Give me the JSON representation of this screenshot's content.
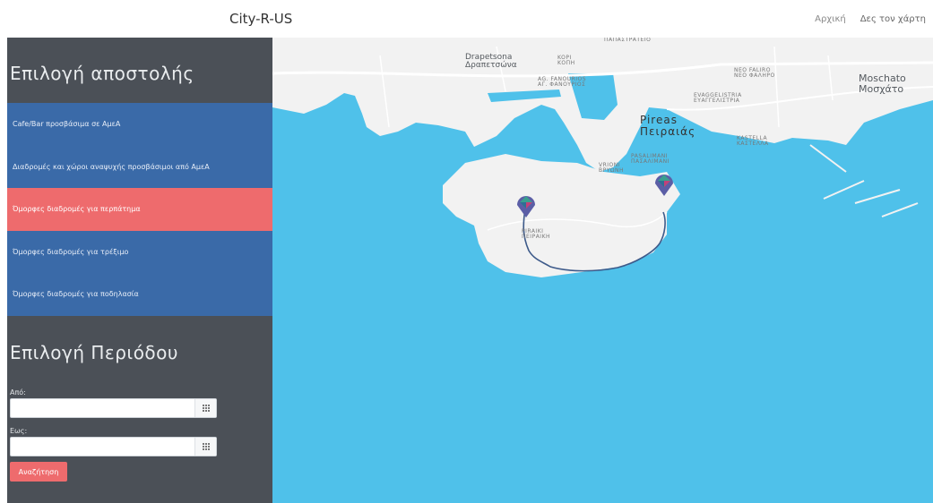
{
  "navbar": {
    "brand": "City-R-US",
    "links": [
      {
        "label": "Αρχική"
      },
      {
        "label": "Δες τον χάρτη"
      }
    ]
  },
  "sidebar": {
    "mission_heading": "Επιλογή αποστολής",
    "missions": [
      {
        "label": "Cafe/Bar προσβάσιμα σε ΑμεΑ",
        "active": false
      },
      {
        "label": "Διαδρομές και χώροι αναψυχής προσβάσιμοι από ΑμεΑ",
        "active": false
      },
      {
        "label": "Όμορφες διαδρομές για περπάτημα",
        "active": true
      },
      {
        "label": "Όμορφες διαδρομές για τρέξιμο",
        "active": false
      },
      {
        "label": "Όμορφες διαδρομές για ποδηλασία",
        "active": false
      }
    ],
    "period_heading": "Επιλογή Περιόδου",
    "from_label": "Από:",
    "from_value": "",
    "to_label": "Εως:",
    "to_value": "",
    "search_label": "Αναζήτηση"
  },
  "map": {
    "labels": {
      "papastratio": "ΠΑΠΑΣΤΡΑΤΕΙΟ",
      "drapetsona": "Drapetsona",
      "drapetsona_gr": "Δραπετσώνα",
      "kopi": "KOPI",
      "kopi_gr": "ΚΟΠΗ",
      "fanourios": "AG. FANOURIOS",
      "fanourios_gr": "ΑΓ. ΦΑΝΟΥΡΙΟΣ",
      "neo_faliro": "NEO FALIRO",
      "neo_faliro_gr": "ΝΕΟ ΦΑΛΗΡΟ",
      "moschato": "Moschato",
      "moschato_gr": "Μοσχάτο",
      "evaggelistria": "EVAGGELISTRIA",
      "evaggelistria_gr": "ΕΥΑΓΓΕΛΙΣΤΡΙΑ",
      "pireas": "Pireas",
      "pireas_gr": "Πειραιάς",
      "kastella": "KASTELLA",
      "kastella_gr": "ΚΑΣΤΕΛΛΑ",
      "pasalimani": "PASALIMANI",
      "pasalimani_gr": "ΠΑΣΑΛΙΜΑΝΙ",
      "vrioni": "VRIONI",
      "vrioni_gr": "ΒΡΥΩΝΗ",
      "piraiki": "PIRAIKI",
      "piraiki_gr": "ΠΕΙΡΑΙΚΗ"
    },
    "marker_colors": [
      "#5b5ea6",
      "#3a9e8f",
      "#c2417a",
      "#2f6f95"
    ]
  }
}
